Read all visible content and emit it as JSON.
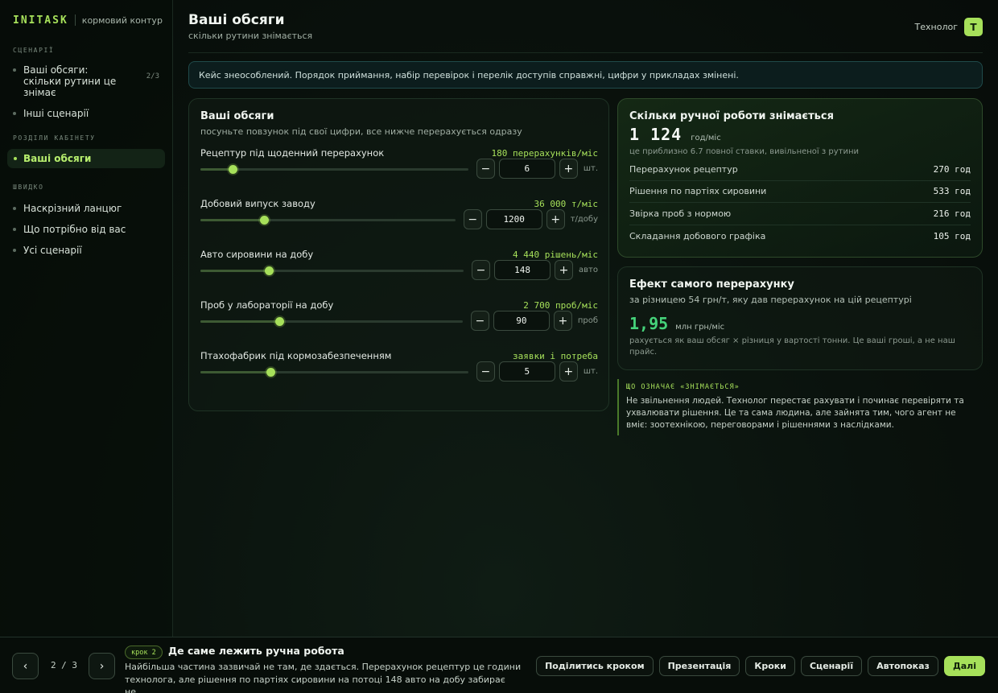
{
  "brand": {
    "logo": "INITASK",
    "subtitle": "кормовий контур"
  },
  "sidebar": {
    "sections": {
      "scenarios": "СЦЕНАРІЇ",
      "cabinet": "РОЗДІЛИ КАБІНЕТУ",
      "quick": "ШВИДКО"
    },
    "scenario_items": [
      {
        "label": "Ваші обсяги: скільки рутини це знімає",
        "count": "2/3"
      },
      {
        "label": "Інші сценарії"
      }
    ],
    "cabinet_items": [
      {
        "label": "Ваші обсяги"
      }
    ],
    "quick_items": [
      {
        "label": "Наскрізний ланцюг"
      },
      {
        "label": "Що потрібно від вас"
      },
      {
        "label": "Усі сценарії"
      }
    ]
  },
  "header": {
    "title": "Ваші обсяги",
    "subtitle": "скільки рутини знімається",
    "user_role": "Технолог",
    "avatar_letter": "Т"
  },
  "notice": "Кейс знеособлений. Порядок приймання, набір перевірок і перелік доступів справжні, цифри у прикладах змінені.",
  "volumes": {
    "title": "Ваші обсяги",
    "subtitle": "посуньте повзунок під свої цифри, все нижче перерахується одразу",
    "minus": "−",
    "plus": "+",
    "rows": [
      {
        "label": "Рецептур під щоденний перерахунок",
        "rate": "180 перерахунків/міс",
        "value": "6",
        "unit": "шт.",
        "level": 0.12
      },
      {
        "label": "Добовий випуск заводу",
        "rate": "36 000 т/міс",
        "value": "1200",
        "unit": "т/добу",
        "level": 0.25
      },
      {
        "label": "Авто сировини на добу",
        "rate": "4 440 рішень/міс",
        "value": "148",
        "unit": "авто",
        "level": 0.26
      },
      {
        "label": "Проб у лабораторії на добу",
        "rate": "2 700 проб/міс",
        "value": "90",
        "unit": "проб",
        "level": 0.3
      },
      {
        "label": "Птахофабрик під кормозабезпеченням",
        "rate": "заявки і потреба",
        "value": "5",
        "unit": "шт.",
        "level": 0.26
      }
    ]
  },
  "summary": {
    "title": "Скільки ручної роботи знімається",
    "value": "1 124",
    "unit": "год/міс",
    "note": "це приблизно 6.7 повної ставки, вивільненої з рутини",
    "breakdown": [
      {
        "label": "Перерахунок рецептур",
        "value": "270 год"
      },
      {
        "label": "Рішення по партіях сировини",
        "value": "533 год"
      },
      {
        "label": "Звірка проб з нормою",
        "value": "216 год"
      },
      {
        "label": "Складання добового графіка",
        "value": "105 год"
      }
    ]
  },
  "effect": {
    "title": "Ефект самого перерахунку",
    "subtitle": "за різницею 54 грн/т, яку дав перерахунок на цій рецептурі",
    "value": "1,95",
    "unit": "млн грн/міс",
    "note": "рахується як ваш обсяг × різниця у вартості тонни. Це ваші гроші, а не наш прайс."
  },
  "meaning": {
    "title": "ЩО ОЗНАЧАЄ «ЗНІМАЄТЬСЯ»",
    "text": "Не звільнення людей. Технолог перестає рахувати і починає перевіряти та ухвалювати рішення. Це та сама людина, але зайнята тим, чого агент не вміє: зоотехнікою, переговорами і рішеннями з наслідками."
  },
  "bottom": {
    "prev": "‹",
    "next": "›",
    "pager": "2 / 3",
    "step_badge": "крок 2",
    "step_title": "Де саме лежить ручна робота",
    "step_text": "Найбільша частина зазвичай не там, де здається. Перерахунок рецептур це години технолога, але рішення по партіях сировини на потоці 148 авто на добу забирає не…",
    "actions": [
      "Поділитись кроком",
      "Презентація",
      "Кроки",
      "Сценарії",
      "Автопоказ",
      "Далі"
    ]
  },
  "colors": {
    "accent": "#a6e05a",
    "effect": "#45d27a",
    "notice_border": "#1f4a4a"
  }
}
